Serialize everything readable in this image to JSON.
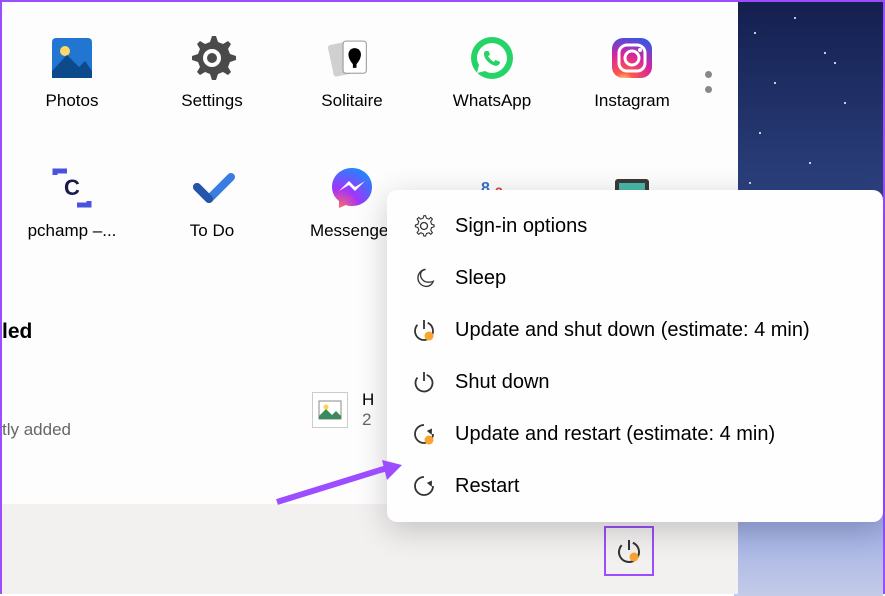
{
  "apps_row1": [
    {
      "name": "photos",
      "label": "Photos"
    },
    {
      "name": "settings",
      "label": "Settings"
    },
    {
      "name": "solitaire",
      "label": "Solitaire"
    },
    {
      "name": "whatsapp",
      "label": "WhatsApp"
    },
    {
      "name": "instagram",
      "label": "Instagram"
    }
  ],
  "apps_row2": [
    {
      "name": "clipchamp",
      "label": "pchamp –..."
    },
    {
      "name": "todo",
      "label": "To Do"
    },
    {
      "name": "messenger",
      "label": "Messenger"
    },
    {
      "name": "snip",
      "label": ""
    },
    {
      "name": "calculator",
      "label": ""
    }
  ],
  "section": {
    "title": "led"
  },
  "recent": {
    "item_label": "",
    "item_sub": "tly added",
    "file_first": "H",
    "file_second": "2"
  },
  "power_menu": {
    "items": [
      {
        "key": "signin",
        "label": "Sign-in options"
      },
      {
        "key": "sleep",
        "label": "Sleep"
      },
      {
        "key": "update-shutdown",
        "label": "Update and shut down (estimate: 4 min)"
      },
      {
        "key": "shutdown",
        "label": "Shut down"
      },
      {
        "key": "update-restart",
        "label": "Update and restart (estimate: 4 min)"
      },
      {
        "key": "restart",
        "label": "Restart"
      }
    ]
  },
  "colors": {
    "accent": "#9b4dff",
    "update_dot": "#f7a431"
  }
}
